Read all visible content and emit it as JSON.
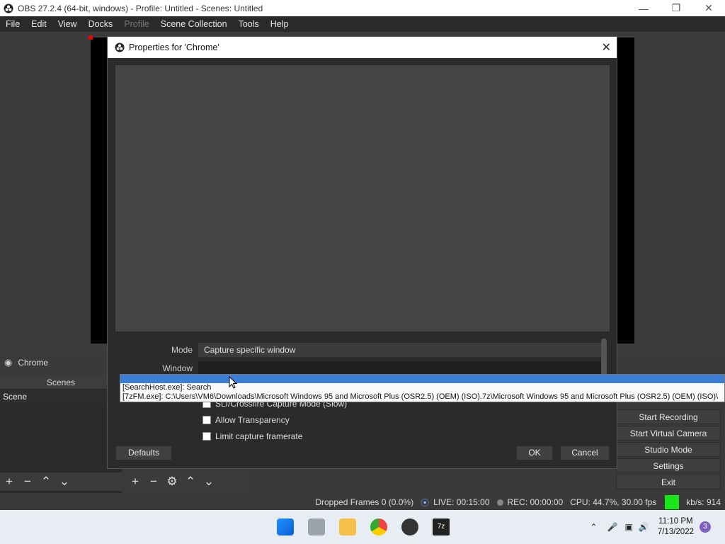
{
  "window": {
    "title": "OBS 27.2.4 (64-bit, windows) - Profile: Untitled - Scenes: Untitled",
    "controls": [
      "minimize-icon",
      "maximize-icon",
      "close-icon"
    ]
  },
  "menubar": {
    "items": [
      "File",
      "Edit",
      "View",
      "Docks",
      "Profile",
      "Scene Collection",
      "Tools",
      "Help"
    ],
    "disabled": [
      "Profile"
    ]
  },
  "sources": {
    "current": "Chrome"
  },
  "scenes": {
    "header": "Scenes",
    "items": [
      "Scene"
    ]
  },
  "controls": {
    "buttons": [
      "Start Recording",
      "Start Virtual Camera",
      "Studio Mode",
      "Settings",
      "Exit"
    ]
  },
  "status": {
    "dropped_frames": "Dropped Frames 0 (0.0%)",
    "live": "LIVE: 00:15:00",
    "rec": "REC: 00:00:00",
    "cpu": "CPU: 44.7%, 30.00 fps",
    "kbps": "kb/s: 914"
  },
  "dialog": {
    "title": "Properties for 'Chrome'",
    "mode_label": "Mode",
    "mode_value": "Capture specific window",
    "window_label": "Window",
    "window_value": "",
    "checkbox_partial": "SLI/Crossfire Capture Mode (Slow)",
    "checkbox_transparency": "Allow Transparency",
    "checkbox_framerate": "Limit capture framerate",
    "defaults_button": "Defaults",
    "ok_button": "OK",
    "cancel_button": "Cancel"
  },
  "dropdown": {
    "items": [
      "[SearchHost.exe]: Search",
      "[7zFM.exe]: C:\\Users\\VM6\\Downloads\\Microsoft Windows 95 and Microsoft Plus (OSR2.5) (OEM) (ISO).7z\\Microsoft Windows 95 and Microsoft Plus (OSR2.5) (OEM) (ISO)\\"
    ]
  },
  "taskbar": {
    "time": "11:10 PM",
    "date": "7/13/2022",
    "notification_count": "3"
  },
  "colors": {
    "selection": "#3b7fd4",
    "status_green": "#19e619"
  }
}
